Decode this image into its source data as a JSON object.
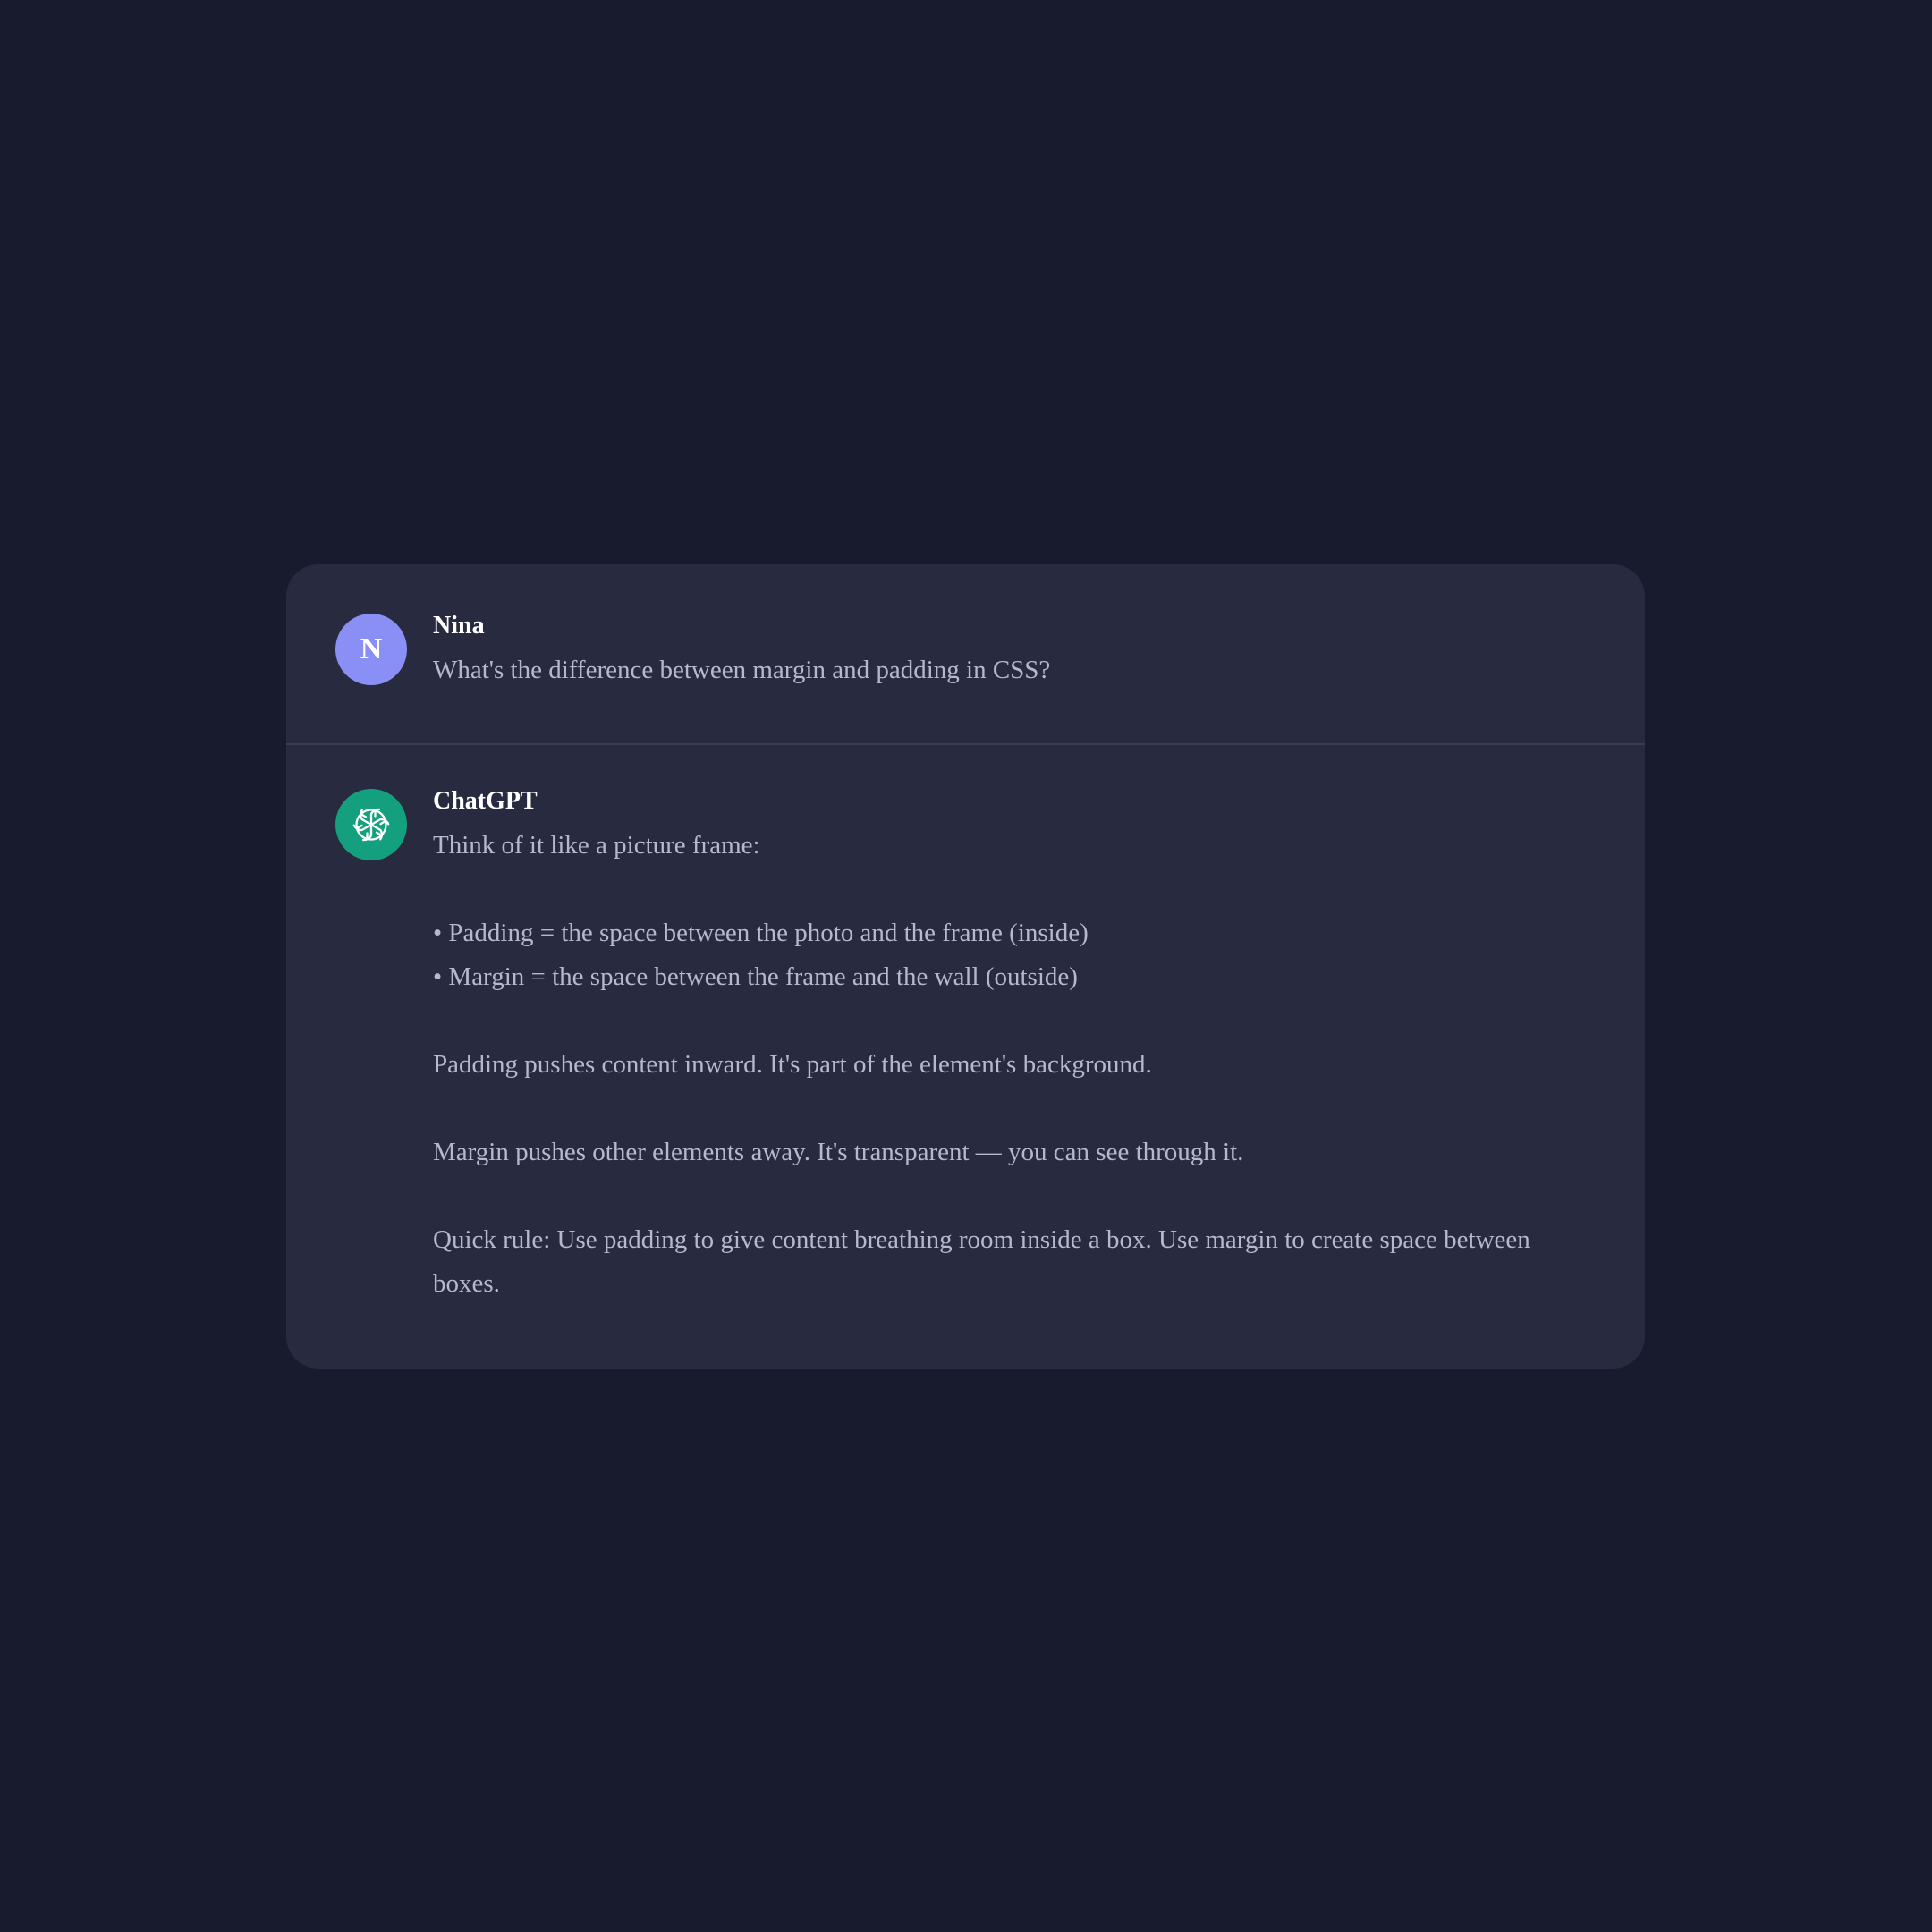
{
  "conversation": {
    "user_message": {
      "avatar_letter": "N",
      "avatar_color": "#8a8ff6",
      "sender": "Nina",
      "text": "What's the difference between margin and padding in CSS?"
    },
    "assistant_message": {
      "avatar_icon": "openai-logo-icon",
      "avatar_color": "#14a07f",
      "sender": "ChatGPT",
      "intro": "Think of it like a picture frame:",
      "bullets": [
        "• Padding = the space between the photo and the frame (inside)",
        "• Margin = the space between the frame and the wall (outside)"
      ],
      "paragraphs": [
        "Padding pushes content inward. It's part of the element's background.",
        "Margin pushes other elements away. It's transparent — you can see through it.",
        "Quick rule: Use padding to give content breathing room inside a box. Use margin to create space between boxes."
      ]
    }
  },
  "colors": {
    "page_background": "#181a2d",
    "card_background": "#282a3f",
    "divider": "#3a3c52",
    "sender_text": "#ffffff",
    "body_text": "#b6b8cc"
  }
}
